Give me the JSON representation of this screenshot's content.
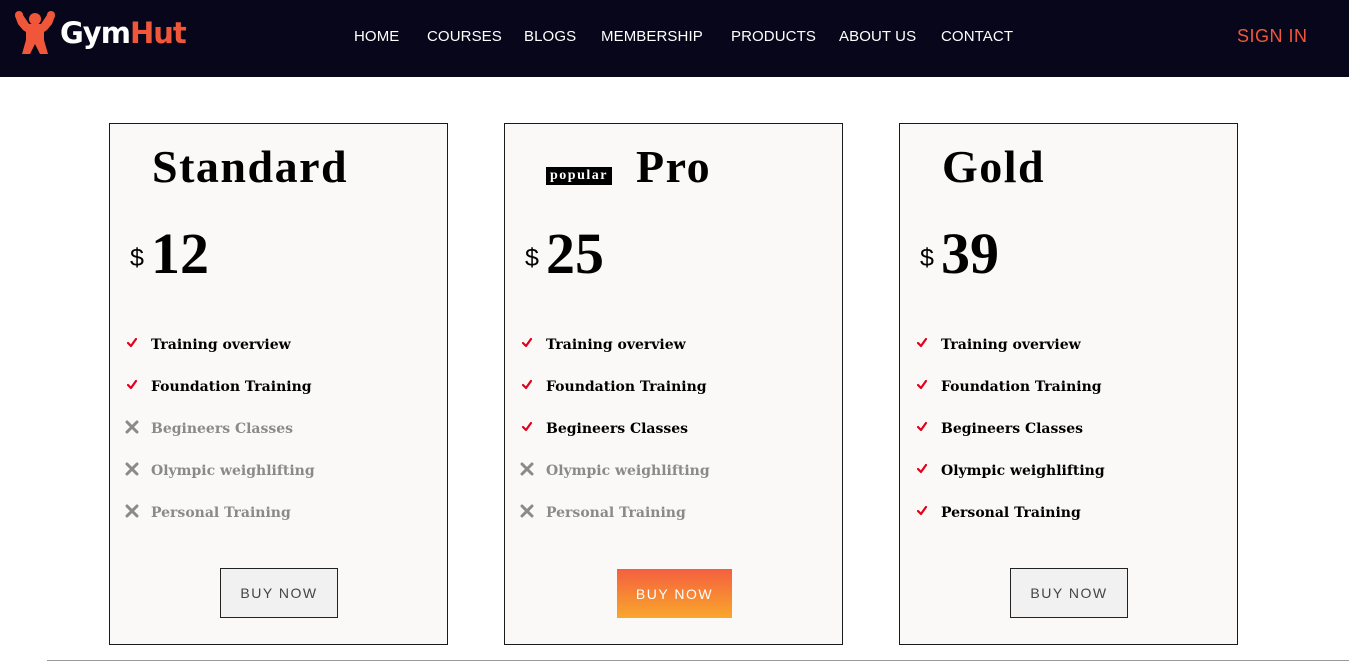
{
  "header": {
    "logo_gym": "Gym",
    "logo_hut": "Hut",
    "logo_icon": "muscle-man-icon",
    "nav": [
      "HOME",
      "COURSES",
      "BLOGS",
      "MEMBERSHIP",
      "PRODUCTS",
      "ABOUT US",
      "CONTACT"
    ],
    "signin": "SIGN IN"
  },
  "colors": {
    "header_bg": "#08061a",
    "accent": "#f0573a",
    "check": "#e3001b",
    "cross": "#8a8a8a"
  },
  "plans": [
    {
      "name": "Standard",
      "badge": "",
      "currency": "$",
      "price": "12",
      "features": [
        {
          "text": "Training overview",
          "included": true
        },
        {
          "text": "Foundation Training",
          "included": true
        },
        {
          "text": "Begineers Classes",
          "included": false
        },
        {
          "text": "Olympic weighlifting",
          "included": false
        },
        {
          "text": "Personal Training",
          "included": false
        }
      ],
      "button": "BUY NOW"
    },
    {
      "name": "Pro",
      "badge": "popular",
      "currency": "$",
      "price": "25",
      "features": [
        {
          "text": "Training overview",
          "included": true
        },
        {
          "text": "Foundation Training",
          "included": true
        },
        {
          "text": "Begineers Classes",
          "included": true
        },
        {
          "text": "Olympic weighlifting",
          "included": false
        },
        {
          "text": "Personal Training",
          "included": false
        }
      ],
      "button": "BUY NOW"
    },
    {
      "name": "Gold",
      "badge": "",
      "currency": "$",
      "price": "39",
      "features": [
        {
          "text": "Training overview",
          "included": true
        },
        {
          "text": "Foundation Training",
          "included": true
        },
        {
          "text": "Begineers Classes",
          "included": true
        },
        {
          "text": "Olympic weighlifting",
          "included": true
        },
        {
          "text": "Personal Training",
          "included": true
        }
      ],
      "button": "BUY NOW"
    }
  ]
}
